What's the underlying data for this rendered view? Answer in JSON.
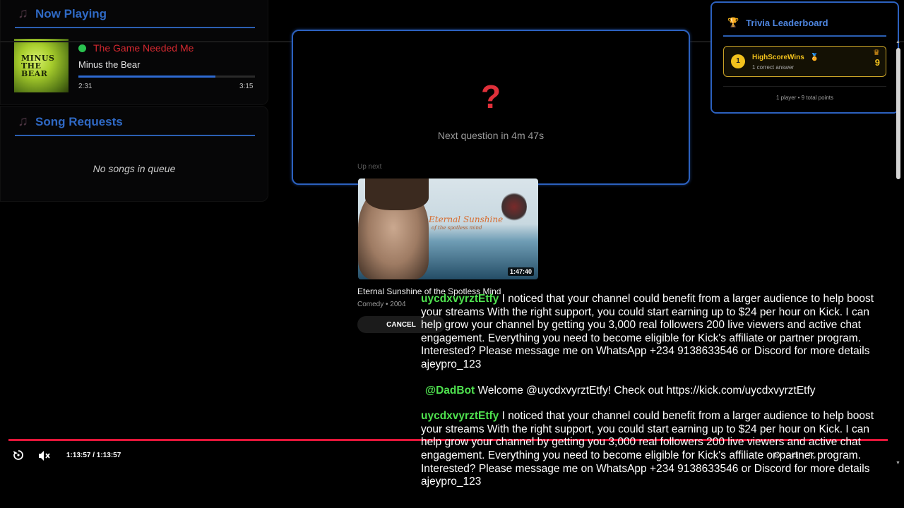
{
  "now_playing": {
    "header": "Now Playing",
    "song_title": "The Game Needed Me",
    "artist": "Minus the Bear",
    "album_text": "MINUS THE BEAR",
    "elapsed": "2:31",
    "duration": "3:15",
    "progress_fraction": 0.774
  },
  "song_requests": {
    "header": "Song Requests",
    "empty_text": "No songs in queue"
  },
  "trivia": {
    "question_mark": "?",
    "next_question": "Next question in 4m 47s"
  },
  "up_next": {
    "label": "Up next",
    "thumbnail_title": "Eternal Sunshine",
    "thumbnail_subtitle": "of the spotless mind",
    "duration": "1:47:40",
    "title": "Eternal Sunshine of the Spotless Mind",
    "meta": "Comedy • 2004",
    "cancel_label": "CANCEL"
  },
  "leaderboard": {
    "title": "Trivia Leaderboard",
    "entries": [
      {
        "rank": "1",
        "name": "HighScoreWins",
        "sub": "1 correct answer",
        "score": "9"
      }
    ],
    "footer": "1 player • 9 total points"
  },
  "chat": [
    {
      "user": "uycdxvyrztEtfy",
      "text": "I noticed that your channel could benefit from a larger audience to help boost your streams With the right support, you could start earning up to $24 per hour on Kick. I can help grow your channel by getting you 3,000 real followers 200 live viewers and active chat engagement. Everything you need to become eligible for Kick's affiliate or partner program. Interested? Please message me on WhatsApp +234 9138633546 or Discord for more details ajeypro_123"
    },
    {
      "user": "@DadBot",
      "text": "Welcome @uycdxvyrztEtfy! Check out https://kick.com/uycdxvyrztEtfy"
    },
    {
      "user": "uycdxvyrztEtfy",
      "text": "I noticed that your channel could benefit from a larger audience to help boost your streams With the right support, you could start earning up to $24 per hour on Kick. I can help grow your channel by getting you 3,000 real followers 200 live viewers and active chat engagement. Everything you need to become eligible for Kick's affiliate or partner program. Interested? Please message me on WhatsApp +234 9138633546 or Discord for more details ajeypro_123"
    }
  ],
  "player": {
    "timecode": "1:13:57 / 1:13:57",
    "icons": [
      "replay-icon",
      "mute-icon",
      "settings-icon",
      "subtitles-icon",
      "fullscreen-icon"
    ]
  },
  "colors": {
    "accent_blue": "#2c61bf",
    "song_red": "#d1282f",
    "chat_green": "#4fe24f",
    "seek_red": "#e5163a",
    "gold": "#f2c21d"
  }
}
